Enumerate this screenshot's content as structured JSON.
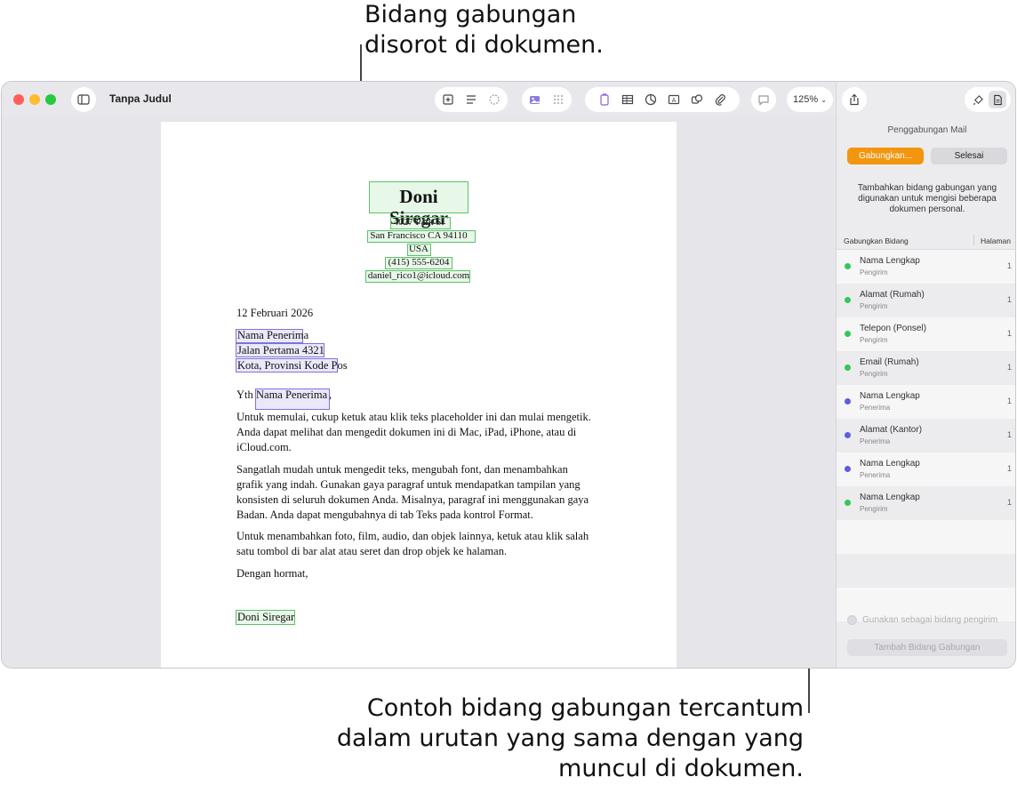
{
  "callouts": {
    "top_line1": "Bidang gabungan",
    "top_line2": "disorot di dokumen.",
    "bottom_line1": "Contoh bidang gabungan tercantum",
    "bottom_line2": "dalam urutan yang sama dengan yang",
    "bottom_line3": "muncul di dokumen."
  },
  "window": {
    "title": "Tanpa Judul",
    "zoom": "125%"
  },
  "toolbar_icons": [
    "sidebar-icon",
    "add-page-icon",
    "text-style-icon",
    "smart-annotation-icon",
    "image-icon",
    "grid-icon",
    "text-box-icon",
    "table-icon",
    "chart-icon",
    "text-icon",
    "shape-icon",
    "attachment-icon",
    "comment-icon",
    "share-icon",
    "format-brush-icon",
    "document-icon"
  ],
  "letter": {
    "sender_name": "Doni Siregar",
    "sender_street": "4027 Park St",
    "sender_city": "San Francisco CA 94110",
    "sender_country": "USA",
    "sender_phone": "(415) 555-6204",
    "sender_email": "daniel_rico1@icloud.com",
    "date": "12 Februari 2026",
    "recipient_name": "Nama Penerima",
    "recipient_street": "Jalan Pertama 4321",
    "recipient_city": "Kota, Provinsi Kode Pos",
    "greeting_prefix": "Yth",
    "greeting_name": "Nama Penerima",
    "greeting_suffix": ",",
    "para1_l1": "Untuk memulai, cukup ketuk atau klik teks placeholder ini dan mulai mengetik.",
    "para1_l2": "Anda dapat melihat dan mengedit dokumen ini di Mac, iPad, iPhone, atau di",
    "para1_l3": "iCloud.com.",
    "para2_l1": "Sangatlah mudah untuk mengedit teks, mengubah font, dan menambahkan",
    "para2_l2": "grafik yang indah. Gunakan gaya paragraf untuk mendapatkan tampilan yang",
    "para2_l3": "konsisten di seluruh dokumen Anda. Misalnya, paragraf ini menggunakan gaya",
    "para2_l4": "Badan. Anda dapat mengubahnya di tab Teks pada kontrol Format.",
    "para3_l1": "Untuk menambahkan foto, film, audio, dan objek lainnya, ketuk atau klik salah",
    "para3_l2": "satu tombol di bar alat atau seret dan drop objek ke halaman.",
    "closing": "Dengan hormat,",
    "signature": "Doni Siregar"
  },
  "sidebar": {
    "heading": "Penggabungan Mail",
    "merge_button": "Gabungkan...",
    "done_button": "Selesai",
    "description": "Tambahkan bidang gabungan yang digunakan untuk mengisi beberapa dokumen personal.",
    "col_field": "Gabungkan Bidang",
    "col_page": "Halaman",
    "rows": [
      {
        "name": "Nama Lengkap",
        "sub": "Pengirim",
        "page": "1",
        "color": "#34c759"
      },
      {
        "name": "Alamat (Rumah)",
        "sub": "Pengirim",
        "page": "1",
        "color": "#34c759"
      },
      {
        "name": "Telepon (Ponsel)",
        "sub": "Pengirim",
        "page": "1",
        "color": "#34c759"
      },
      {
        "name": "Email (Rumah)",
        "sub": "Pengirim",
        "page": "1",
        "color": "#34c759"
      },
      {
        "name": "Nama Lengkap",
        "sub": "Penerima",
        "page": "1",
        "color": "#5e5ce6"
      },
      {
        "name": "Alamat (Kantor)",
        "sub": "Penerima",
        "page": "1",
        "color": "#5e5ce6"
      },
      {
        "name": "Nama Lengkap",
        "sub": "Penerima",
        "page": "1",
        "color": "#5e5ce6"
      },
      {
        "name": "Nama Lengkap",
        "sub": "Pengirim",
        "page": "1",
        "color": "#34c759"
      }
    ],
    "use_as_sender": "Gunakan sebagai bidang pengirim",
    "add_field_button": "Tambah Bidang Gabungan"
  }
}
